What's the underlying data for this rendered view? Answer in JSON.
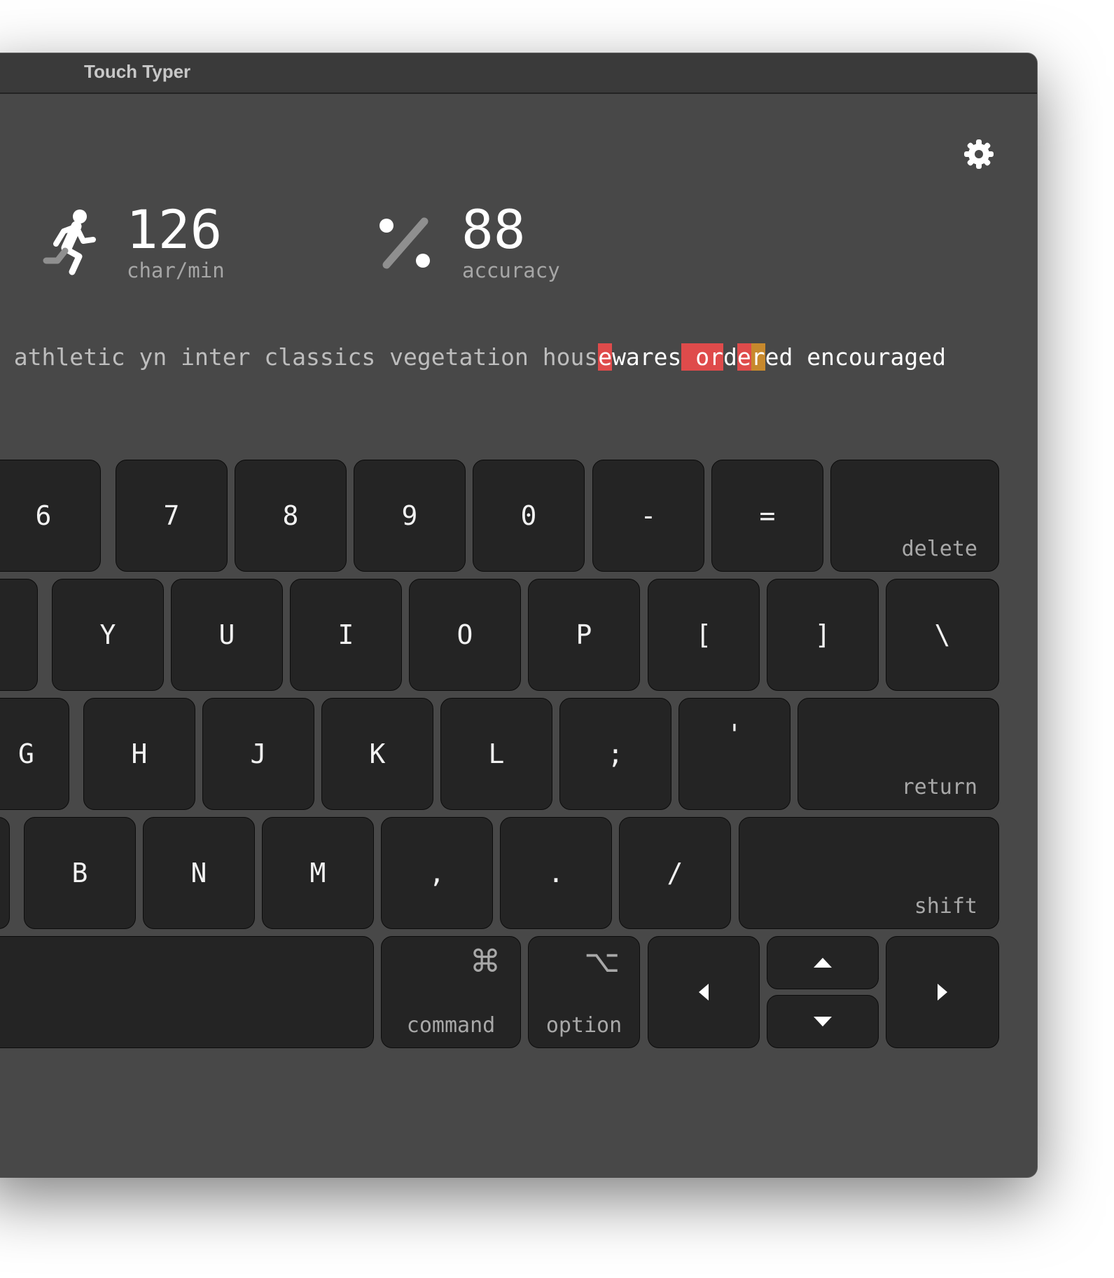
{
  "window": {
    "title": "Touch Typer"
  },
  "stats": {
    "speed": {
      "value": "126",
      "label": "char/min",
      "icon": "running-person-icon"
    },
    "accuracy": {
      "value": "88",
      "label": "accuracy",
      "icon": "percent-icon"
    }
  },
  "toolbar": {
    "settings_icon": "gear-icon"
  },
  "typing": {
    "done": "n athletic yn inter classics vegetation hous",
    "err1": "e",
    "cur_a": "wares",
    "err2": " or",
    "cur_b": "d",
    "err3": "e",
    "warn1": "r",
    "cur_c": "ed",
    "next": " encouraged"
  },
  "keyboard": {
    "number_row": [
      "6",
      "7",
      "8",
      "9",
      "0",
      "-",
      "="
    ],
    "delete_label": "delete",
    "top_row": [
      "Y",
      "U",
      "I",
      "O",
      "P",
      "[",
      "]",
      "\\"
    ],
    "home_row": [
      "G",
      "H",
      "J",
      "K",
      "L",
      ";",
      "'"
    ],
    "return_label": "return",
    "bottom_row": [
      "B",
      "N",
      "M",
      ",",
      ".",
      "/"
    ],
    "shift_label": "shift",
    "command_label": "command",
    "command_glyph": "⌘",
    "option_label": "option",
    "option_glyph": "⌥"
  },
  "colors": {
    "window_bg": "#484848",
    "key_bg": "#242424",
    "error_highlight": "#df4b4b",
    "warning_highlight": "#c7892d"
  }
}
